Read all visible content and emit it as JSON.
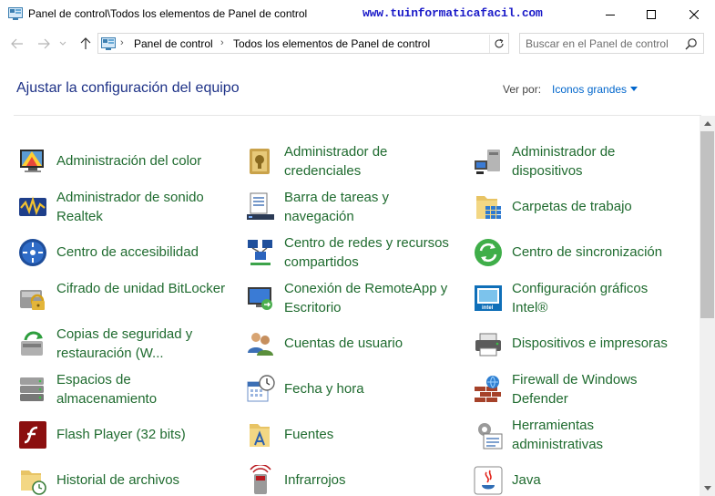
{
  "window": {
    "title": "Panel de control\\Todos los elementos de Panel de control",
    "watermark": "www.tuinformaticafacil.com"
  },
  "address": {
    "crumbs": [
      "Panel de control",
      "Todos los elementos de Panel de control"
    ]
  },
  "search": {
    "placeholder": "Buscar en el Panel de control"
  },
  "header": {
    "title": "Ajustar la configuración del equipo",
    "view_by_label": "Ver por:",
    "view_by_value": "Iconos grandes"
  },
  "items": [
    {
      "label": "Administración del color",
      "icon": "color-management-icon"
    },
    {
      "label": "Administrador de credenciales",
      "icon": "credential-manager-icon"
    },
    {
      "label": "Administrador de dispositivos",
      "icon": "device-manager-icon"
    },
    {
      "label": "Administrador de sonido Realtek",
      "icon": "realtek-audio-icon"
    },
    {
      "label": "Barra de tareas y navegación",
      "icon": "taskbar-icon"
    },
    {
      "label": "Carpetas de trabajo",
      "icon": "work-folders-icon"
    },
    {
      "label": "Centro de accesibilidad",
      "icon": "ease-of-access-icon"
    },
    {
      "label": "Centro de redes y recursos compartidos",
      "icon": "network-center-icon"
    },
    {
      "label": "Centro de sincronización",
      "icon": "sync-center-icon"
    },
    {
      "label": "Cifrado de unidad BitLocker",
      "icon": "bitlocker-icon"
    },
    {
      "label": "Conexión de RemoteApp y Escritorio",
      "icon": "remoteapp-icon"
    },
    {
      "label": "Configuración gráficos Intel®",
      "icon": "intel-graphics-icon"
    },
    {
      "label": "Copias de seguridad y restauración (W...",
      "icon": "backup-restore-icon"
    },
    {
      "label": "Cuentas de usuario",
      "icon": "user-accounts-icon"
    },
    {
      "label": "Dispositivos e impresoras",
      "icon": "devices-printers-icon"
    },
    {
      "label": "Espacios de almacenamiento",
      "icon": "storage-spaces-icon"
    },
    {
      "label": "Fecha y hora",
      "icon": "date-time-icon"
    },
    {
      "label": "Firewall de Windows Defender",
      "icon": "firewall-icon"
    },
    {
      "label": "Flash Player (32 bits)",
      "icon": "flash-player-icon"
    },
    {
      "label": "Fuentes",
      "icon": "fonts-icon"
    },
    {
      "label": "Herramientas administrativas",
      "icon": "admin-tools-icon"
    },
    {
      "label": "Historial de archivos",
      "icon": "file-history-icon"
    },
    {
      "label": "Infrarrojos",
      "icon": "infrared-icon"
    },
    {
      "label": "Java",
      "icon": "java-icon"
    }
  ],
  "colors": {
    "title_blue": "#1e3287",
    "link_green": "#1f6b2f",
    "accent_blue": "#0066cc",
    "watermark_blue": "#1a1ac8"
  }
}
